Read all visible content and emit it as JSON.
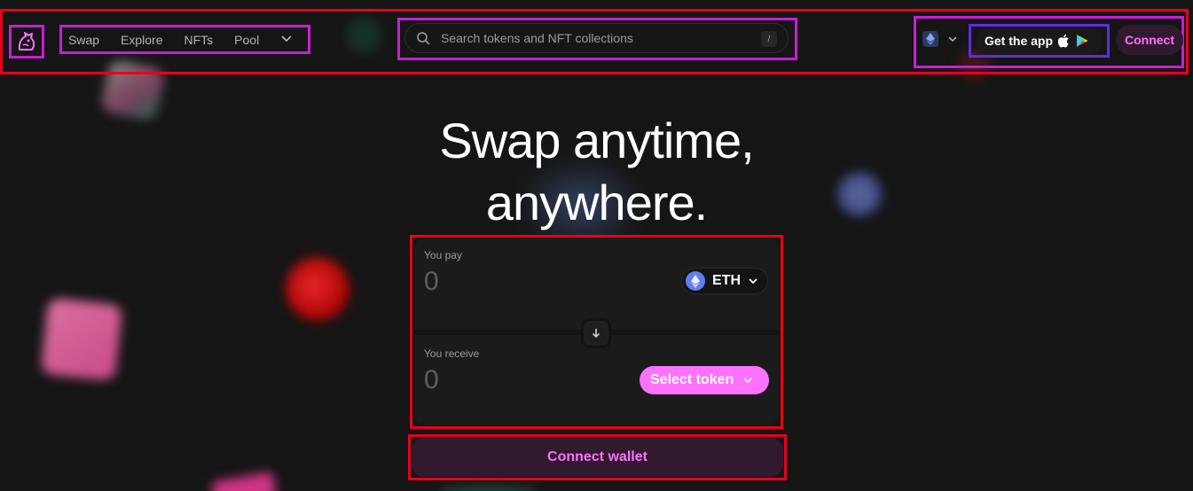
{
  "nav": {
    "links": [
      "Swap",
      "Explore",
      "NFTs",
      "Pool"
    ],
    "more_icon": "chevron-down-icon",
    "search_placeholder": "Search tokens and NFT collections",
    "search_shortcut": "/",
    "chain_icon": "ethereum-icon",
    "get_app_label": "Get the app",
    "connect_label": "Connect"
  },
  "hero": {
    "line1": "Swap anytime,",
    "line2": "anywhere."
  },
  "swap": {
    "pay_label": "You pay",
    "pay_amount": "0",
    "pay_token": "ETH",
    "receive_label": "You receive",
    "receive_amount": "0",
    "receive_token_label": "Select token",
    "connect_wallet_label": "Connect wallet"
  },
  "colors": {
    "background": "#131313",
    "accent_pink": "#fc72ff",
    "connect_bg": "#311a2e",
    "annotation_red": "#e8001c",
    "annotation_magenta": "#c81ed6",
    "annotation_blue": "#5b2fe0"
  }
}
